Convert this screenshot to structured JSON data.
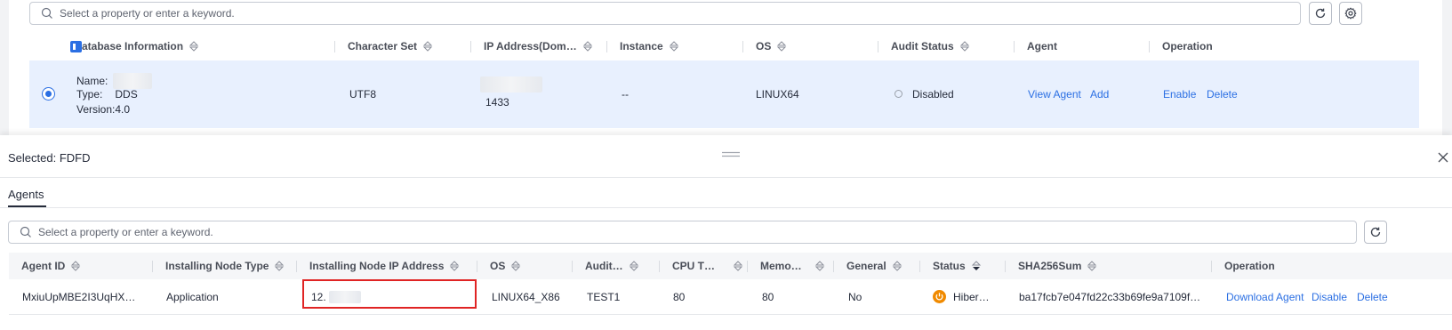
{
  "top": {
    "search": {
      "placeholder": "Select a property or enter a keyword."
    },
    "columns": {
      "db_info": "atabase Information",
      "charset": "Character Set",
      "ip": "IP Address(Dom…",
      "instance": "Instance",
      "os": "OS",
      "audit_status": "Audit Status",
      "agent": "Agent",
      "operation": "Operation"
    },
    "row": {
      "name_label": "Name:",
      "type_label": "Type:",
      "type_value": "DDS",
      "version_label": "Version:",
      "version_value": "4.0",
      "charset": "UTF8",
      "port": "1433",
      "instance": "--",
      "os": "LINUX64",
      "audit_status": "Disabled",
      "view_agent": "View Agent",
      "add": "Add",
      "enable": "Enable",
      "delete": "Delete"
    }
  },
  "panel": {
    "selected_label": "Selected: FDFD",
    "tab": "Agents",
    "search": {
      "placeholder": "Select a property or enter a keyword."
    },
    "columns": {
      "agent_id": "Agent ID",
      "node_type": "Installing Node Type",
      "node_ip": "Installing Node IP Address",
      "os": "OS",
      "audit": "Audit…",
      "cpu": "CPU T…",
      "memory": "Memo…",
      "general": "General",
      "status": "Status",
      "sha": "SHA256Sum",
      "operation": "Operation"
    },
    "row": {
      "agent_id": "MxiuUpMBE2I3UqHX…",
      "node_type": "Application",
      "node_ip": "12.",
      "os": "LINUX64_X86",
      "audit": "TEST1",
      "cpu": "80",
      "memory": "80",
      "general": "No",
      "status": "Hiber…",
      "sha": "ba17fcb7e047fd22c33b69fe9a7109f…",
      "download_agent": "Download Agent",
      "disable": "Disable",
      "delete": "Delete"
    }
  },
  "colors": {
    "accent": "#2b6fe3",
    "row_highlight": "#e8f0fe",
    "status_hibernate": "#f08a00",
    "highlight_box": "#e02424"
  }
}
